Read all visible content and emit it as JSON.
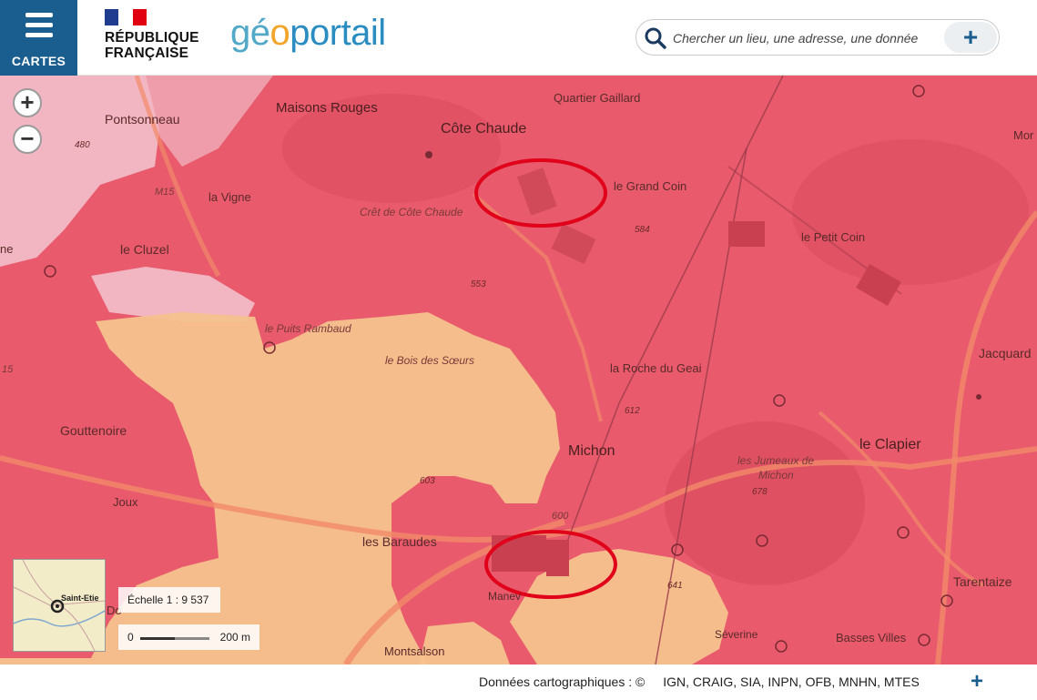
{
  "header": {
    "menu_label": "CARTES",
    "republique_line1": "RÉPUBLIQUE",
    "republique_line2": "FRANÇAISE",
    "brand_part1": "gé",
    "brand_part2": "o",
    "brand_part3": "portail",
    "search_placeholder": "Chercher un lieu, une adresse, une donnée",
    "search_plus": "+"
  },
  "colors": {
    "brand_blue": "#1a5e8f",
    "risk_high": "#e85a6c",
    "risk_low": "#f5c28e",
    "annotation_circle": "#e0001a"
  },
  "zoom": {
    "in": "+",
    "out": "−"
  },
  "map_labels": {
    "pontsonneau": "Pontsonneau",
    "maisons_rouges": "Maisons Rouges",
    "cote_chaude": "Côte Chaude",
    "quartier_gaillard": "Quartier Gaillard",
    "le_grand_coin": "le Grand Coin",
    "mor": "Mor",
    "la_vigne": "la Vigne",
    "cret_cote_chaude": "Crêt de Côte Chaude",
    "le_petit_coin": "le Petit Coin",
    "le_cluzel": "le Cluzel",
    "ne": "ne",
    "le_puits_rambaud": "le Puits Rambaud",
    "jacquard": "Jacquard",
    "le_bois_des_soeurs": "le Bois des Sœurs",
    "la_roche_du_geai": "la Roche du Geai",
    "gouttenoire": "Gouttenoire",
    "michon": "Michon",
    "le_clapier": "le Clapier",
    "les_jumeaux_l1": "les Jumeaux de",
    "les_jumeaux_l2": "Michon",
    "joux": "Joux",
    "les_baraudes": "les Baraudes",
    "tarentaize": "Tarentaize",
    "manev": "Manev",
    "severine": "Séverine",
    "basses_villes": "Basses Villes",
    "montsalson": "Montsalson",
    "do": "Do",
    "road_m15": "M15",
    "road_15": "15",
    "road_600": "600",
    "alt_480": "480",
    "alt_584": "584",
    "alt_553": "553",
    "alt_612": "612",
    "alt_603": "603",
    "alt_678": "678",
    "alt_641": "641"
  },
  "overview": {
    "label": "Saint-Etie"
  },
  "scale": {
    "ratio_text": "Échelle 1 : 9 537",
    "zero": "0",
    "distance": "200 m"
  },
  "footer": {
    "credits_prefix": "Données cartographiques : ©",
    "providers": "IGN, CRAIG, SIA, INPN, OFB, MNHN, MTES",
    "plus": "+"
  }
}
